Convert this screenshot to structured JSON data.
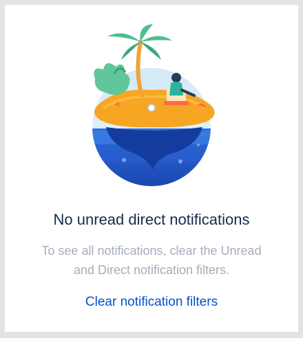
{
  "empty_state": {
    "title": "No unread direct notifications",
    "message_line1": "To see all notifications, clear the Unread",
    "message_line2": "and Direct notification filters.",
    "action_label": "Clear notification filters"
  },
  "colors": {
    "title": "#172b4d",
    "message": "#a5adba",
    "link": "#0052cc",
    "sky": "#d9eef8",
    "ocean": "#1f4fc1",
    "sand": "#f6a623"
  },
  "icons": [
    "island-illustration"
  ]
}
